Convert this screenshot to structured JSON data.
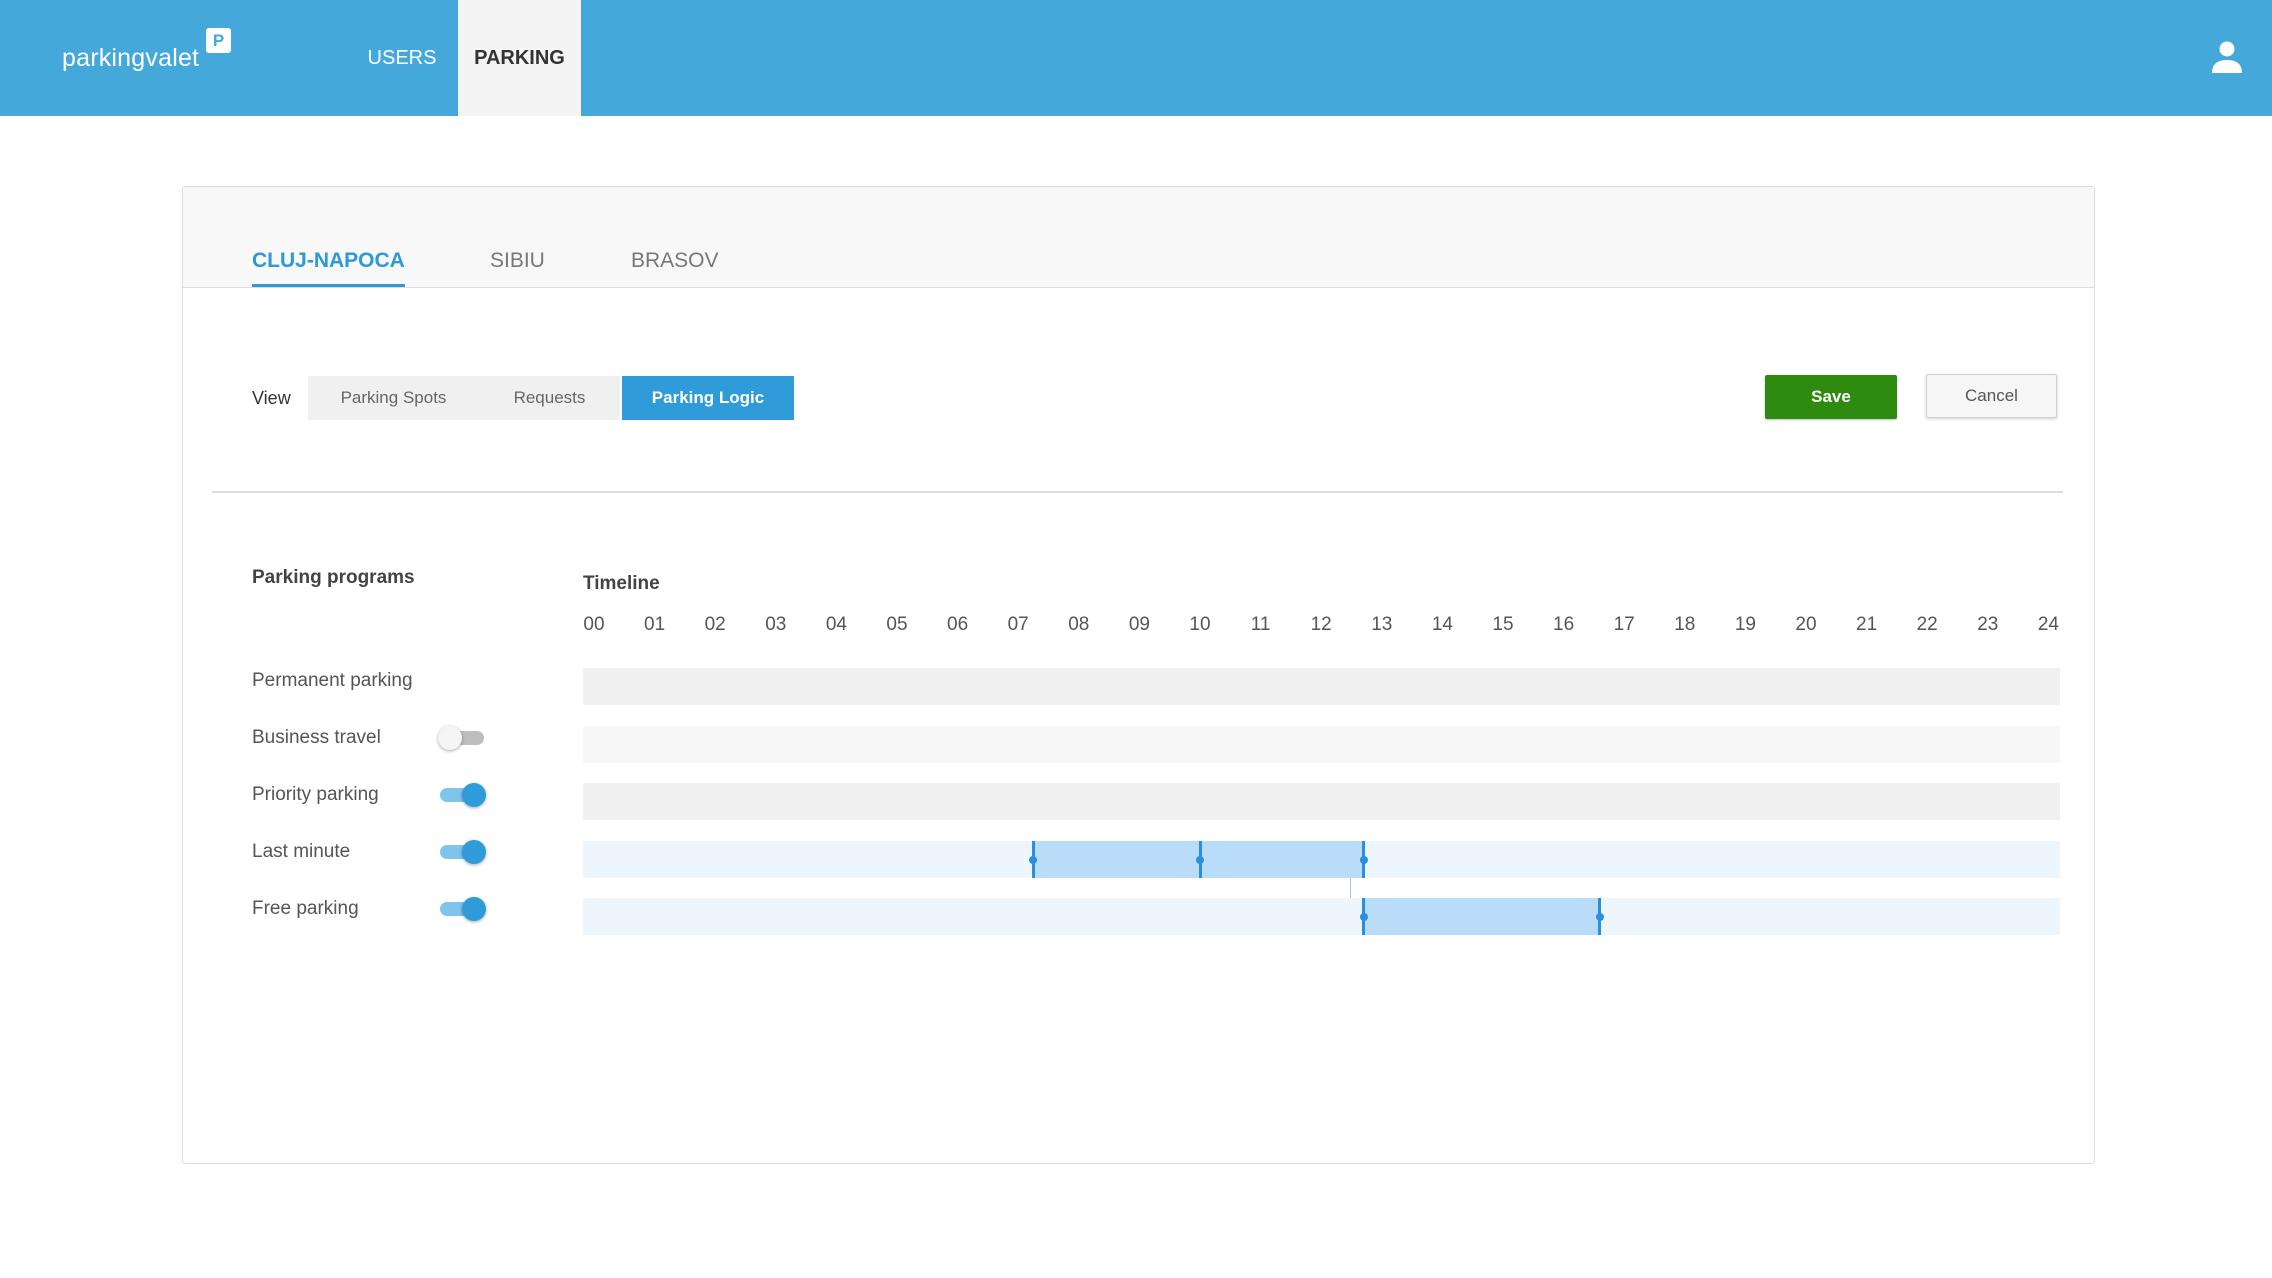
{
  "app": {
    "logo_text": "parkingvalet",
    "logo_badge": "P"
  },
  "nav": {
    "items": [
      {
        "label": "USERS",
        "active": false
      },
      {
        "label": "PARKING",
        "active": true
      }
    ],
    "user_icon": "person-icon"
  },
  "city_tabs": [
    {
      "label": "CLUJ-NAPOCA",
      "active": true
    },
    {
      "label": "SIBIU",
      "active": false
    },
    {
      "label": "BRASOV",
      "active": false
    }
  ],
  "view": {
    "label": "View",
    "options": [
      {
        "label": "Parking Spots",
        "selected": false
      },
      {
        "label": "Requests",
        "selected": false
      },
      {
        "label": "Parking Logic",
        "selected": true
      }
    ]
  },
  "actions": {
    "save_label": "Save",
    "cancel_label": "Cancel"
  },
  "programs": {
    "title": "Parking programs",
    "items": [
      {
        "label": "Permanent parking",
        "toggle": null,
        "ranges": []
      },
      {
        "label": "Business travel",
        "toggle": false,
        "ranges": []
      },
      {
        "label": "Priority parking",
        "toggle": true,
        "ranges": []
      },
      {
        "label": "Last minute",
        "toggle": true,
        "ranges": [
          {
            "start": 7.25,
            "end": 12.7,
            "split": 10.0
          }
        ]
      },
      {
        "label": "Free parking",
        "toggle": true,
        "ranges": [
          {
            "start": 12.7,
            "end": 16.6
          }
        ]
      }
    ]
  },
  "timeline": {
    "title": "Timeline",
    "hours": [
      "00",
      "01",
      "02",
      "03",
      "04",
      "05",
      "06",
      "07",
      "08",
      "09",
      "10",
      "11",
      "12",
      "13",
      "14",
      "15",
      "16",
      "17",
      "18",
      "19",
      "20",
      "21",
      "22",
      "23",
      "24"
    ]
  },
  "colors": {
    "brand": "#44a8db",
    "accent": "#2f9bd8",
    "save": "#2f8a10",
    "range_fill": "#b9ddf8",
    "handle": "#2b8fe0"
  }
}
